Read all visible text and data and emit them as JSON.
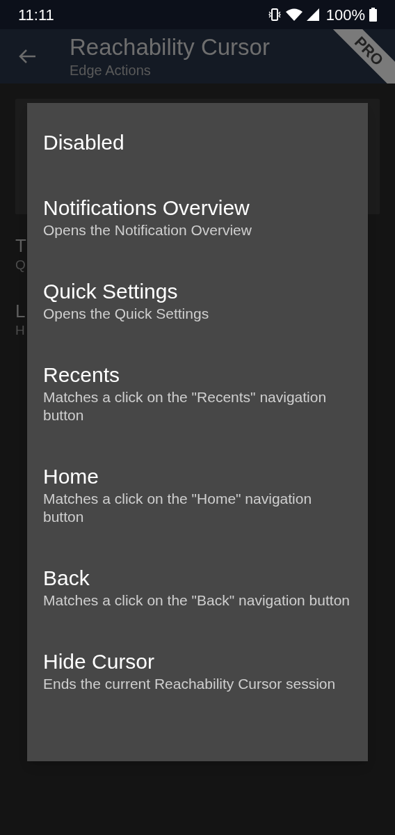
{
  "status_bar": {
    "time": "11:11",
    "battery": "100%"
  },
  "app_bar": {
    "title": "Reachability Cursor",
    "subtitle": "Edge Actions",
    "ribbon": "PRO"
  },
  "background_rows": [
    {
      "title": "T",
      "subtitle": "Q"
    },
    {
      "title": "L",
      "subtitle": "H"
    }
  ],
  "dialog": {
    "options": [
      {
        "title": "Disabled"
      },
      {
        "title": "Notifications Overview",
        "subtitle": "Opens the Notification Overview"
      },
      {
        "title": "Quick Settings",
        "subtitle": "Opens the Quick Settings"
      },
      {
        "title": "Recents",
        "subtitle": "Matches a click on the \"Recents\" navigation button"
      },
      {
        "title": "Home",
        "subtitle": "Matches a click on the \"Home\" navigation button"
      },
      {
        "title": "Back",
        "subtitle": "Matches a click on the \"Back\" navigation button"
      },
      {
        "title": "Hide Cursor",
        "subtitle": "Ends the current Reachability Cursor session"
      }
    ]
  }
}
